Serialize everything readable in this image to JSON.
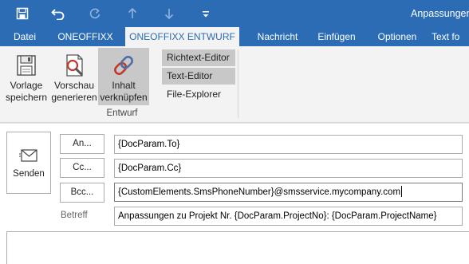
{
  "titlebar": {
    "title": "Anpassungen"
  },
  "quick_access": {
    "save_icon": "save-icon",
    "undo_icon": "undo-icon",
    "redo_icon": "redo-icon",
    "up_icon": "arrow-up-icon",
    "down_icon": "arrow-down-icon",
    "more_icon": "customize-icon"
  },
  "tabs": [
    {
      "label": "Datei"
    },
    {
      "label": "ONEOFFIXX"
    },
    {
      "label": "ONEOFFIXX ENTWURF"
    },
    {
      "label": "Nachricht"
    },
    {
      "label": "Einfügen"
    },
    {
      "label": "Optionen"
    },
    {
      "label": "Text fo"
    }
  ],
  "ribbon": {
    "save_template": {
      "line1": "Vorlage",
      "line2": "speichern"
    },
    "preview": {
      "line1": "Vorschau",
      "line2": "generieren"
    },
    "link_content": {
      "line1": "Inhalt",
      "line2": "verknüpfen"
    },
    "richtext_editor": "Richtext-Editor",
    "text_editor": "Text-Editor",
    "file_explorer": "File-Explorer",
    "group_label": "Entwurf"
  },
  "compose": {
    "send_label": "Senden",
    "to_button": "An...",
    "cc_button": "Cc...",
    "bcc_button": "Bcc...",
    "subject_label": "Betreff",
    "to_value": "{DocParam.To}",
    "cc_value": "{DocParam.Cc}",
    "bcc_value": "{CustomElements.SmsPhoneNumber}@smsservice.mycompany.com",
    "subject_value": "Anpassungen zu Projekt Nr. {DocParam.ProjectNo}: {DocParam.ProjectName}"
  },
  "colors": {
    "accent": "#2b6cb5",
    "ribbon_bg": "#f3f3f3",
    "selected_bg": "#c8c8c8"
  }
}
